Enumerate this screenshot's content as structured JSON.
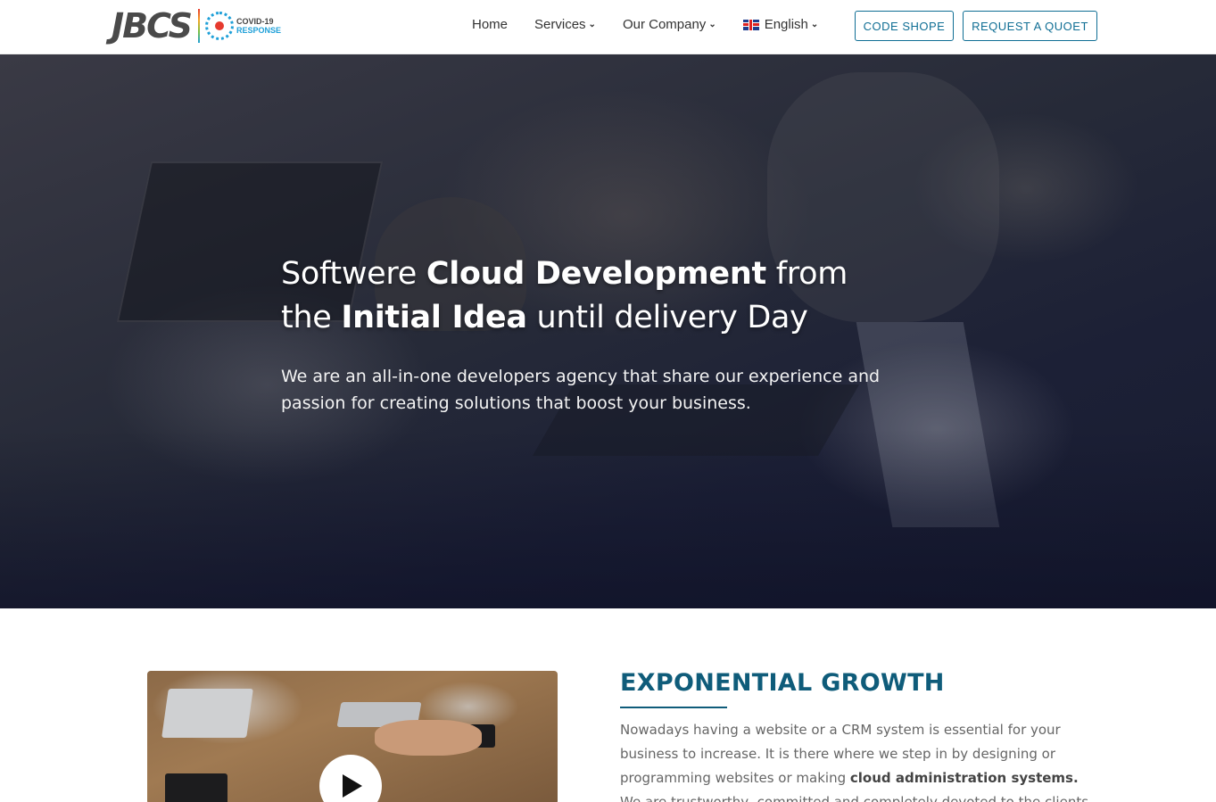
{
  "header": {
    "logo_text": "JBCS",
    "badge_line1": "COVID-19",
    "badge_line2": "RESPONSE",
    "nav": {
      "home": "Home",
      "services": "Services",
      "company": "Our Company",
      "language": "English"
    },
    "code_shop_label": "CODE SHOPE",
    "quote_label": "REQUEST A QUOET"
  },
  "hero": {
    "t1": "Softwere ",
    "t2": "Cloud Development",
    "t3": " from",
    "t4": "the ",
    "t5": "Initial Idea",
    "t6": " until delivery Day",
    "subtitle": "We are an all-in-one developers agency that share our experience and passion for creating solutions that boost your business."
  },
  "growth": {
    "title": "EXPONENTIAL GROWTH",
    "p1": "Nowadays having a website or a CRM system is essential for your business to increase. It is there where we step in by designing or programming websites or making ",
    "p1_bold": "cloud administration systems.",
    "p1_end": " We are trustworthy, committed and completely devoted to the clients and"
  },
  "colors": {
    "brand": "#0f6e94",
    "title": "#0f5c7a"
  },
  "icons": {
    "play": "play-icon",
    "flag": "uk-flag-icon",
    "chevron": "chevron-down-icon"
  }
}
